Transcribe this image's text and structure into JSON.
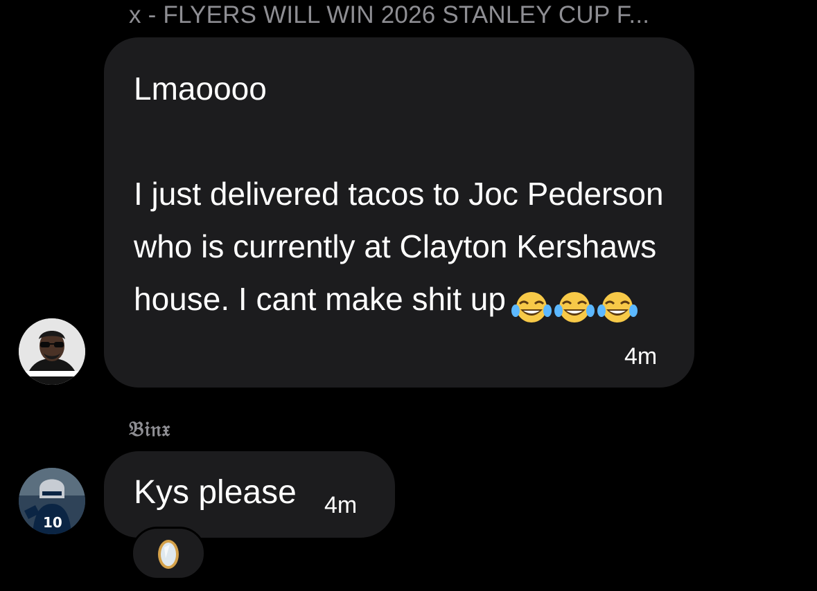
{
  "thread": {
    "message_1": {
      "sender": "x - FLYERS WILL WIN 2026 STANLEY CUP F...",
      "text": "Lmaoooo\n\nI just delivered tacos to Joc Pederson who is currently at Clayton Kershaws house. I cant make shit up",
      "emojis": [
        "face-with-tears-of-joy",
        "face-with-tears-of-joy",
        "face-with-tears-of-joy"
      ],
      "time": "4m"
    },
    "message_2": {
      "sender": "𝔅𝔦𝔫𝔵",
      "text": "Kys please",
      "time": "4m",
      "reaction": "mirror-emoji"
    }
  },
  "colors": {
    "background": "#000000",
    "bubble": "#1c1c1e",
    "secondary_text": "#8e8e93"
  }
}
